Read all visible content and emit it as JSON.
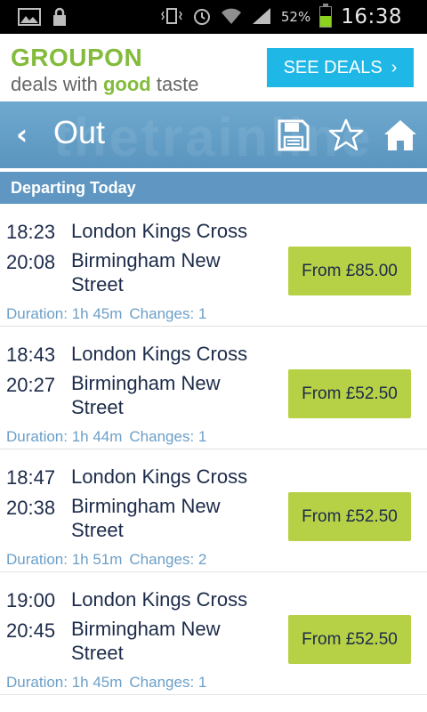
{
  "status_bar": {
    "battery_percent": "52%",
    "time": "16:38",
    "battery_level": 0.52
  },
  "ad": {
    "brand": "GROUPON",
    "tagline_prefix": "deals with ",
    "tagline_highlight": "good",
    "tagline_suffix": " taste",
    "cta": "SEE DEALS",
    "brand_color": "#83bb3a",
    "cta_color": "#1fb7e6"
  },
  "toolbar": {
    "back_glyph": "‹",
    "title": "Out",
    "watermark": "thetrainline"
  },
  "section": {
    "title": "Departing Today"
  },
  "journeys": [
    {
      "depart_time": "18:23",
      "depart_station": "London Kings Cross",
      "arrive_time": "20:08",
      "arrive_station": "Birmingham New Street",
      "duration": "Duration: 1h 45m",
      "changes": "Changes: 1",
      "price": "From £85.00"
    },
    {
      "depart_time": "18:43",
      "depart_station": "London Kings Cross",
      "arrive_time": "20:27",
      "arrive_station": "Birmingham New Street",
      "duration": "Duration: 1h 44m",
      "changes": "Changes: 1",
      "price": "From £52.50"
    },
    {
      "depart_time": "18:47",
      "depart_station": "London Kings Cross",
      "arrive_time": "20:38",
      "arrive_station": "Birmingham New Street",
      "duration": "Duration: 1h 51m",
      "changes": "Changes: 2",
      "price": "From £52.50"
    },
    {
      "depart_time": "19:00",
      "depart_station": "London Kings Cross",
      "arrive_time": "20:45",
      "arrive_station": "Birmingham New Street",
      "duration": "Duration: 1h 45m",
      "changes": "Changes: 1",
      "price": "From £52.50"
    }
  ],
  "colors": {
    "toolbar": "#5f97c2",
    "price_button": "#b7d146",
    "meta_text": "#6c9fc8",
    "primary_text": "#1c2b4a"
  }
}
